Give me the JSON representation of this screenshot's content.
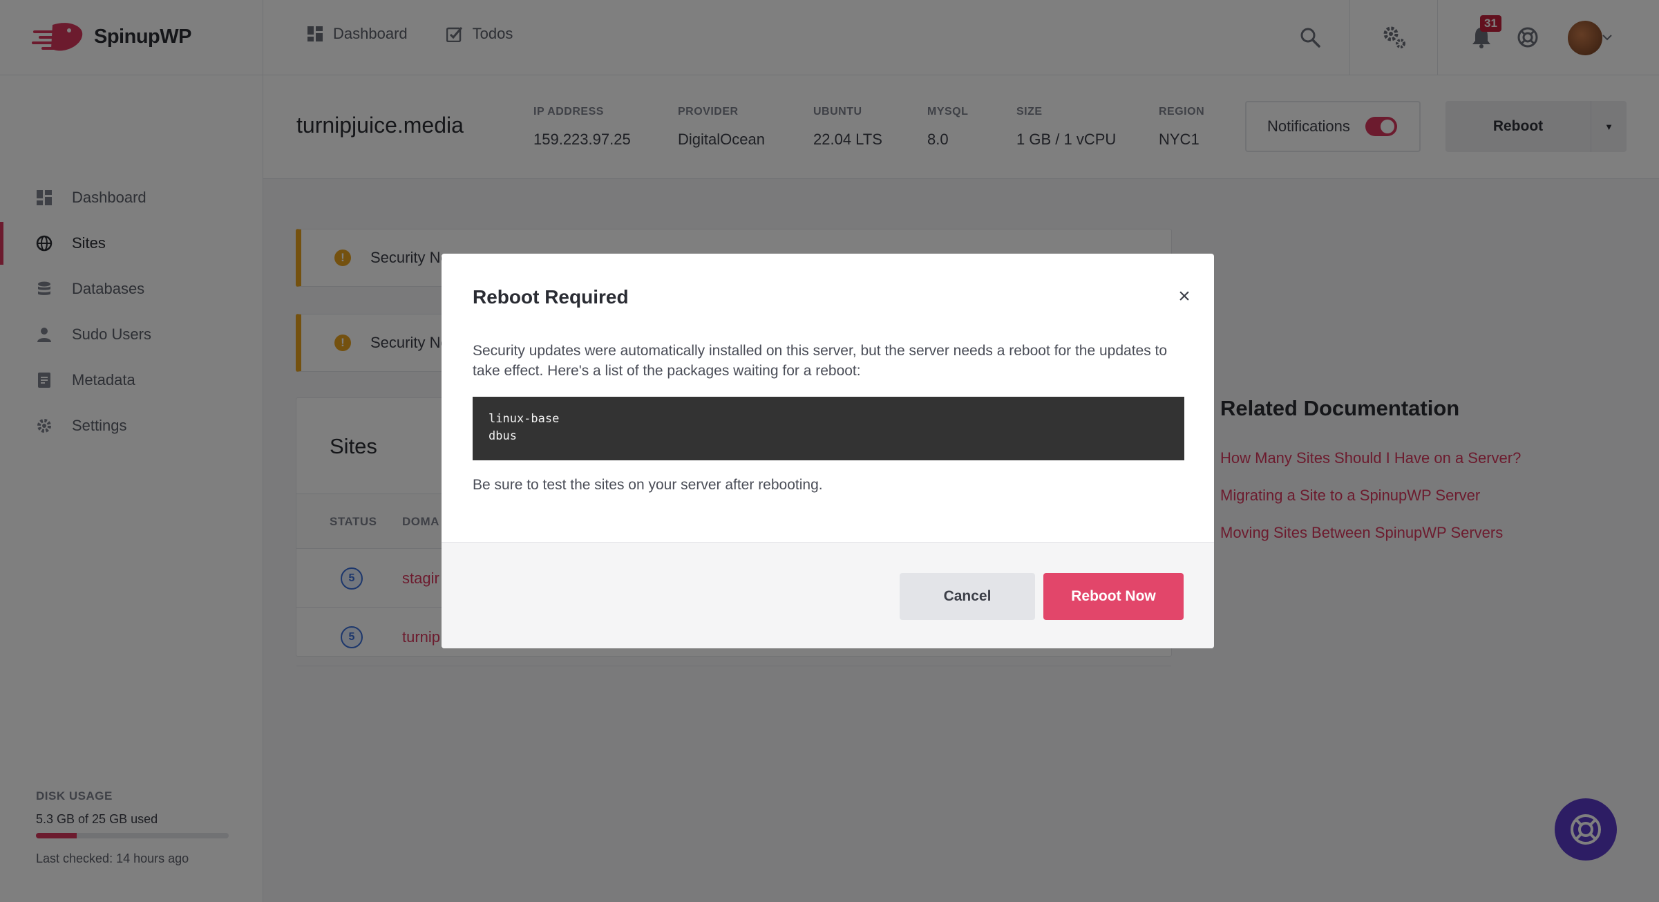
{
  "app": {
    "name": "SpinupWP"
  },
  "topnav": {
    "items": [
      {
        "label": "Dashboard",
        "icon": "dashboard-icon"
      },
      {
        "label": "Todos",
        "icon": "todos-icon"
      }
    ],
    "notification_count": "31"
  },
  "sidebar": {
    "items": [
      {
        "label": "Dashboard",
        "icon": "dashboard-icon",
        "active": false
      },
      {
        "label": "Sites",
        "icon": "globe-icon",
        "active": true
      },
      {
        "label": "Databases",
        "icon": "database-icon",
        "active": false
      },
      {
        "label": "Sudo Users",
        "icon": "user-icon",
        "active": false
      },
      {
        "label": "Metadata",
        "icon": "metadata-icon",
        "active": false
      },
      {
        "label": "Settings",
        "icon": "gear-icon",
        "active": false
      }
    ],
    "disk": {
      "label": "DISK USAGE",
      "value": "5.3 GB of 25 GB used",
      "fraction": 0.212,
      "checked": "Last checked: 14 hours ago"
    }
  },
  "server": {
    "name": "turnipjuice.media",
    "meta": [
      {
        "label": "IP ADDRESS",
        "value": "159.223.97.25"
      },
      {
        "label": "PROVIDER",
        "value": "DigitalOcean"
      },
      {
        "label": "UBUNTU",
        "value": "22.04 LTS"
      },
      {
        "label": "MYSQL",
        "value": "8.0"
      },
      {
        "label": "SIZE",
        "value": "1 GB / 1 vCPU"
      },
      {
        "label": "REGION",
        "value": "NYC1"
      }
    ],
    "notifications_label": "Notifications",
    "notifications_on": true,
    "reboot_label": "Reboot"
  },
  "alerts": [
    {
      "text": "Security No"
    },
    {
      "text": "Security No"
    }
  ],
  "sites": {
    "title": "Sites",
    "columns": [
      "STATUS",
      "DOMA"
    ],
    "rows": [
      {
        "status": "5",
        "domain": "stagir"
      },
      {
        "status": "5",
        "domain": "turnip"
      }
    ]
  },
  "docs": {
    "title": "Related Documentation",
    "links": [
      "How Many Sites Should I Have on a Server?",
      "Migrating a Site to a SpinupWP Server",
      "Moving Sites Between SpinupWP Servers"
    ]
  },
  "modal": {
    "title": "Reboot Required",
    "close": "×",
    "description": "Security updates were automatically installed on this server, but the server needs a reboot for the updates to take effect. Here's a list of the packages waiting for a reboot:",
    "packages": [
      "linux-base",
      "dbus"
    ],
    "note": "Be sure to test the sites on your server after rebooting.",
    "cancel_label": "Cancel",
    "confirm_label": "Reboot Now"
  },
  "colors": {
    "accent": "#e2466a",
    "warning": "#e8a21f",
    "help": "#5b3bc9"
  }
}
